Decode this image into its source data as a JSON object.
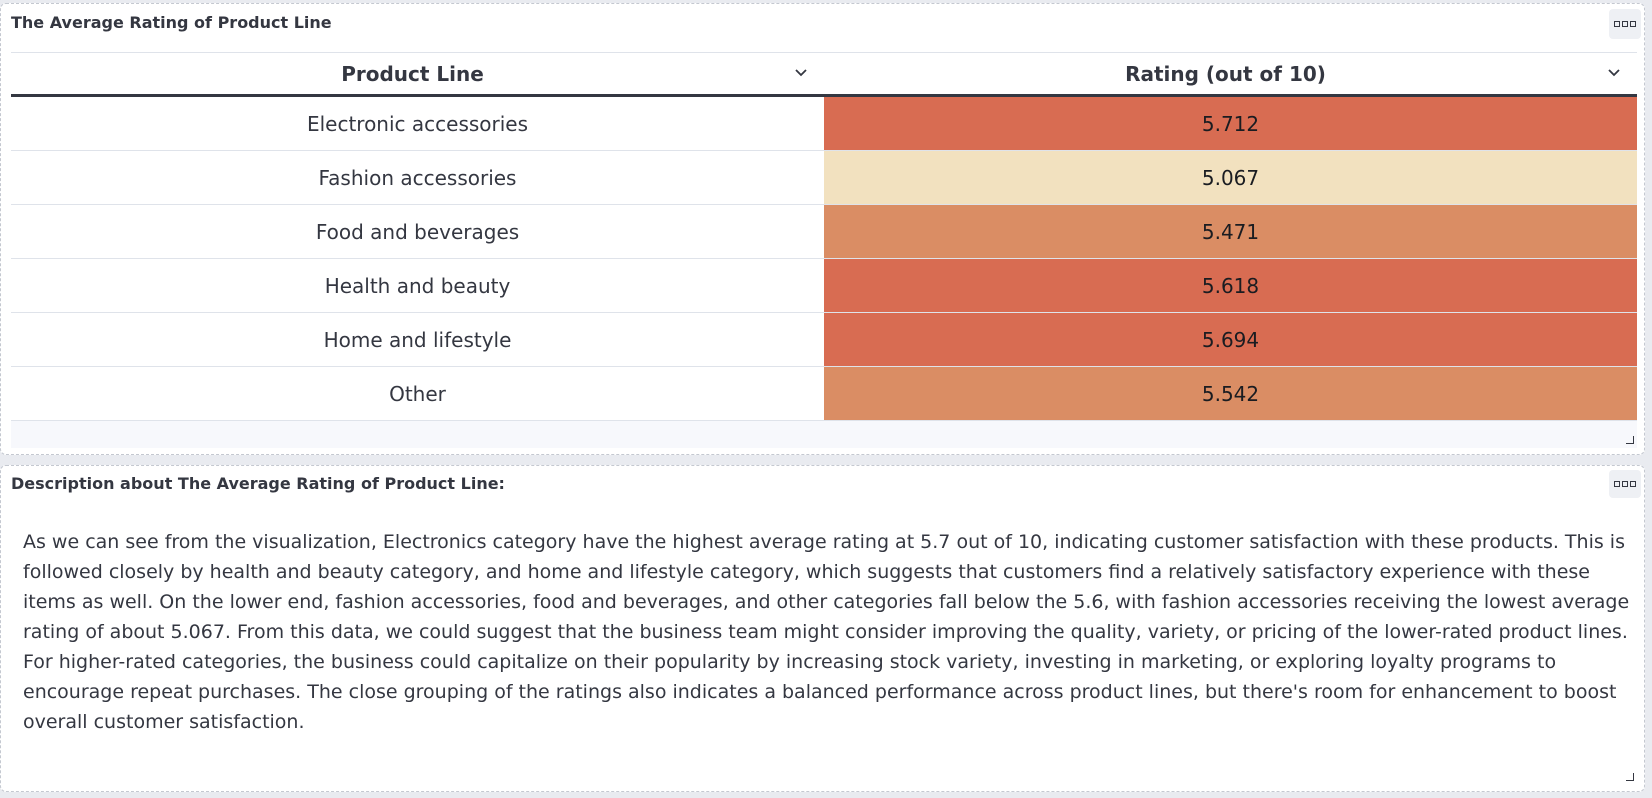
{
  "table_panel": {
    "title": "The Average Rating of Product Line",
    "columns": [
      "Product Line",
      "Rating (out of 10)"
    ],
    "rows": [
      {
        "product_line": "Electronic accessories",
        "rating": "5.712",
        "color": "#d86c52"
      },
      {
        "product_line": "Fashion accessories",
        "rating": "5.067",
        "color": "#f2e1bf"
      },
      {
        "product_line": "Food and beverages",
        "rating": "5.471",
        "color": "#da8d64"
      },
      {
        "product_line": "Health and beauty",
        "rating": "5.618",
        "color": "#d86c52"
      },
      {
        "product_line": "Home and lifestyle",
        "rating": "5.694",
        "color": "#d86c52"
      },
      {
        "product_line": "Other",
        "rating": "5.542",
        "color": "#da8d64"
      }
    ],
    "options_icon": "ellipsis-box-icon",
    "resize_icon": "resize-corner-icon"
  },
  "desc_panel": {
    "title": "Description about The Average Rating of Product Line:",
    "text": "As we can see from the visualization, Electronics category have the highest average rating at 5.7 out of 10, indicating customer satisfaction with these products. This is followed closely by health and beauty category, and home and lifestyle category, which suggests that customers find a relatively satisfactory experience with these items as well. On the lower end, fashion accessories, food and beverages, and other categories fall below the 5.6, with fashion accessories receiving the lowest average rating of about 5.067. From this data, we could suggest that the business team might consider improving the quality, variety, or pricing of the lower-rated product lines. For higher-rated categories, the business could capitalize on their popularity by increasing stock variety, investing in marketing, or exploring loyalty programs to encourage repeat purchases. The close grouping of the ratings also indicates a balanced performance across product lines, but there's room for enhancement to boost overall customer satisfaction.",
    "options_icon": "ellipsis-box-icon",
    "resize_icon": "resize-corner-icon"
  }
}
